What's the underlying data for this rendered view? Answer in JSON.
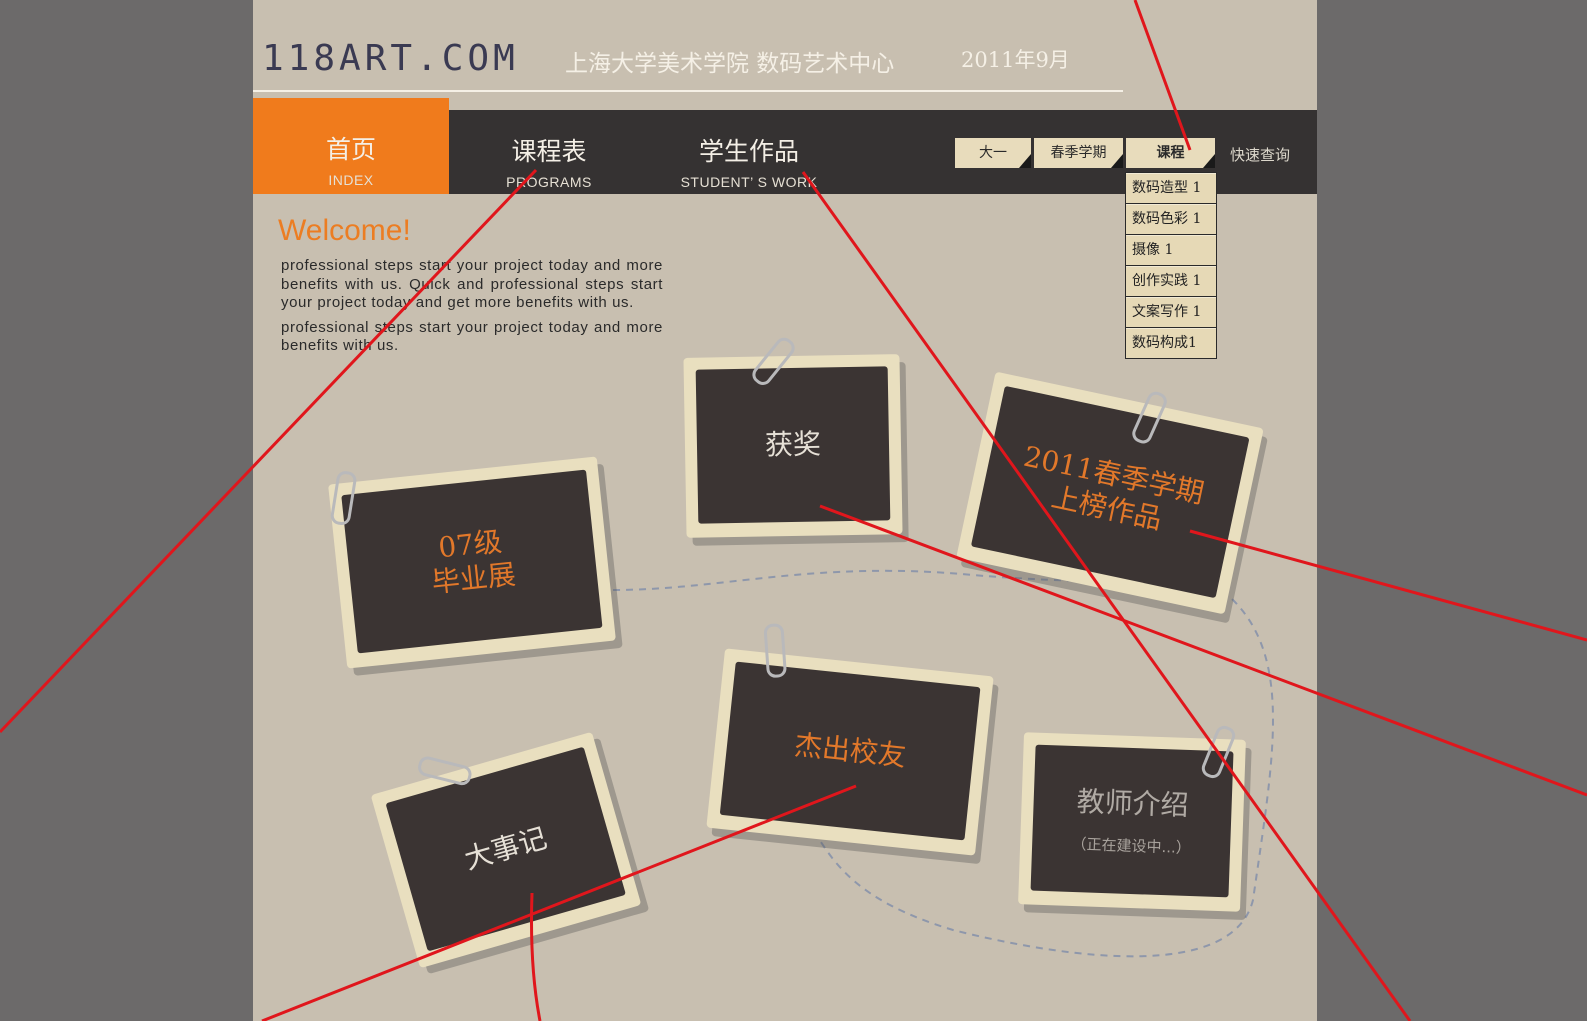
{
  "header": {
    "logo": "118ART.COM",
    "subtitle": "上海大学美术学院  数码艺术中心",
    "date": "2011年9月"
  },
  "nav": [
    {
      "zh": "首页",
      "en": "INDEX"
    },
    {
      "zh": "课程表",
      "en": "PROGRAMS"
    },
    {
      "zh": "学生作品",
      "en": "STUDENT’ S WORK"
    }
  ],
  "tabs": [
    "大一",
    "春季学期",
    "课程"
  ],
  "quick_search": "快速查询",
  "dropdown": [
    "数码造型 1",
    "数码色彩 1",
    "摄像 1",
    "创作实践 1",
    "文案写作 1",
    "数码构成1"
  ],
  "welcome": {
    "title": "Welcome!",
    "para1": "professional steps start your project today and more benefits with us. Quick and professional steps start your project today and get more benefits with us.",
    "para2": "professional steps start your project today and more benefits with us."
  },
  "cards": {
    "graduation": [
      "07级",
      "毕业展"
    ],
    "awards": "获奖",
    "spring": [
      "2011春季学期",
      "上榜作品"
    ],
    "events": "大事记",
    "alumni": "杰出校友",
    "teachers": "教师介绍",
    "teachers_sub": "（正在建设中...）"
  },
  "colors": {
    "accent": "#f07b1c",
    "navbar": "#353232",
    "page": "#c8bfb0",
    "annotation_line": "#e0161c"
  }
}
